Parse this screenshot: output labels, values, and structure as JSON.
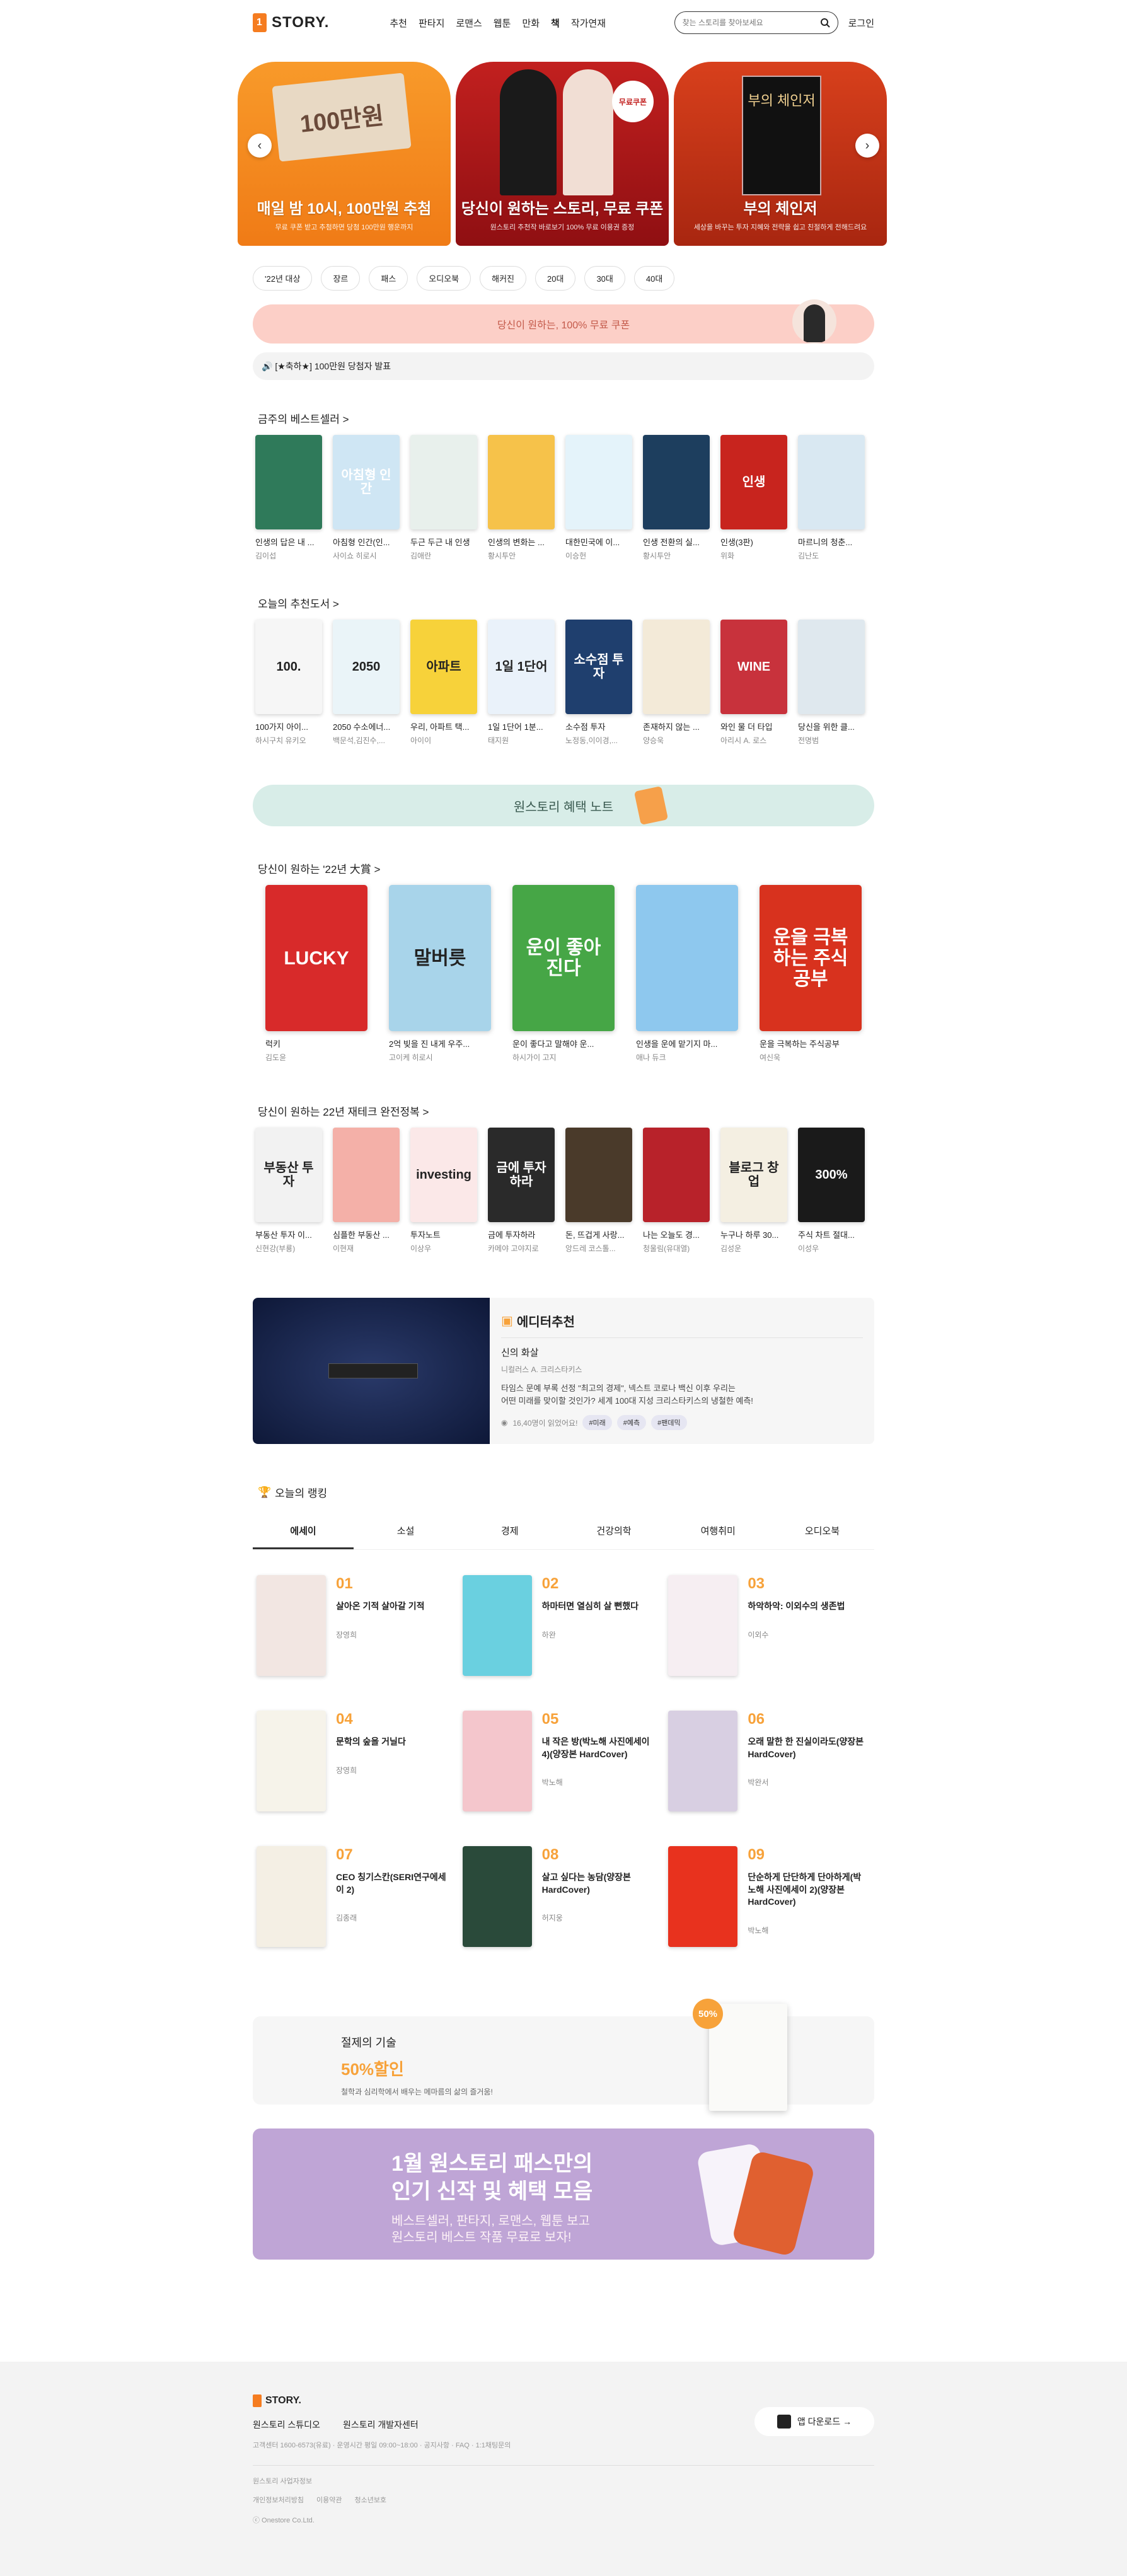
{
  "header": {
    "logo": "STORY.",
    "nav": [
      "추천",
      "판타지",
      "로맨스",
      "웹툰",
      "만화",
      "책",
      "작가연재"
    ],
    "active_nav": 5,
    "search_placeholder": "찾는 스토리를 찾아보세요",
    "login": "로그인"
  },
  "hero": {
    "slides": [
      {
        "envelope": "100만원",
        "title": "매일 밤 10시, 100만원 추첨",
        "sub": "무료 쿠폰 받고 추첨하면 당첨 100만원 행운까지"
      },
      {
        "badge": "무료쿠폰",
        "title": "당신이 원하는 스토리, 무료 쿠폰",
        "sub": "원스토리 추천작 바로보기 100% 무료 이용권 증정"
      },
      {
        "book": "부의 체인저",
        "title": "부의 체인저",
        "sub": "세상을 바꾸는 투자 지혜와 전략을 쉽고 친절하게 전해드려요"
      }
    ]
  },
  "tags": [
    "'22년 대상",
    "장르",
    "패스",
    "오디오북",
    "해커진",
    "20대",
    "30대",
    "40대"
  ],
  "pink_banner": "당신이 원하는, 100% 무료 쿠폰",
  "notice": "🔊 [★축하★] 100만원 당첨자 발표",
  "bestseller": {
    "title": "금주의 베스트셀러 >",
    "books": [
      {
        "t": "인생의 답은 내 ...",
        "a": "김이섭",
        "cover": "#2f7a5a",
        "txt": ""
      },
      {
        "t": "아침형 인간(인...",
        "a": "사이쇼 히로시",
        "cover": "#cfe6f4",
        "txt": "아침형 인간"
      },
      {
        "t": "두근 두근 내 인생",
        "a": "김애란",
        "cover": "#e8f0ec",
        "txt": ""
      },
      {
        "t": "인생의 변화는 ...",
        "a": "황시투안",
        "cover": "#f6c24a",
        "txt": ""
      },
      {
        "t": "대한민국에 이...",
        "a": "이승헌",
        "cover": "#e4f3fa",
        "txt": ""
      },
      {
        "t": "인생 전환의 실...",
        "a": "황시투안",
        "cover": "#1d3e5e",
        "txt": ""
      },
      {
        "t": "인생(3판)",
        "a": "위화",
        "cover": "#c8241e",
        "txt": "인생"
      },
      {
        "t": "마르니의 청춘...",
        "a": "김난도",
        "cover": "#d9e8f2",
        "txt": ""
      }
    ]
  },
  "recommend": {
    "title": "오늘의 추천도서 >",
    "books": [
      {
        "t": "100가지 아이...",
        "a": "하시구치 유키오",
        "cover": "#f6f6f6",
        "txt": "100."
      },
      {
        "t": "2050 수소에너...",
        "a": "백문석,김진수,...",
        "cover": "#eaf4f8",
        "txt": "2050"
      },
      {
        "t": "우리, 아파트 택...",
        "a": "아이이",
        "cover": "#f7d23a",
        "txt": "아파트"
      },
      {
        "t": "1일 1단어 1분...",
        "a": "태지원",
        "cover": "#eaf2fa",
        "txt": "1일 1단어"
      },
      {
        "t": "소수점 투자",
        "a": "노정동,이이경,...",
        "cover": "#1f3f6e",
        "txt": "소수점 투자"
      },
      {
        "t": "존재하지 않는 ...",
        "a": "양승욱",
        "cover": "#f3ead8",
        "txt": ""
      },
      {
        "t": "와인 물 더 타입",
        "a": "아리시 A. 로스",
        "cover": "#c8323c",
        "txt": "WINE"
      },
      {
        "t": "당신을 위한 클...",
        "a": "전명범",
        "cover": "#dfe8ee",
        "txt": ""
      }
    ]
  },
  "benefit": "원스토리 혜택 노트",
  "award": {
    "title": "당신이 원하는 '22년 大賞 >",
    "books": [
      {
        "t": "럭키",
        "a": "김도윤",
        "cover": "#d82a2a",
        "txt": "LUCKY"
      },
      {
        "t": "2억 빚을 진 내게 우주...",
        "a": "고이케 히로시",
        "cover": "#a8d4ea",
        "txt": "말버릇"
      },
      {
        "t": "운이 좋다고 말해야 운...",
        "a": "하시가이 고지",
        "cover": "#46a646",
        "txt": "운이 좋아진다"
      },
      {
        "t": "인생을 운에 맡기지 마...",
        "a": "애나 듀크",
        "cover": "#8ec8ee",
        "txt": ""
      },
      {
        "t": "운을 극복하는 주식공부",
        "a": "여신욱",
        "cover": "#d8321e",
        "txt": "운을 극복하는 주식공부"
      }
    ]
  },
  "invest": {
    "title": "당신이 원하는 22년 재테크 완전정복 >",
    "books": [
      {
        "t": "부동산 투자 이...",
        "a": "신현강(부룡)",
        "cover": "#f2f2f2",
        "txt": "부동산 투자"
      },
      {
        "t": "심플한 부동산 ...",
        "a": "이현재",
        "cover": "#f4b0a8",
        "txt": ""
      },
      {
        "t": "투자노트",
        "a": "이상우",
        "cover": "#fbe8e8",
        "txt": "investing"
      },
      {
        "t": "금에 투자하라",
        "a": "카메야 고야지로",
        "cover": "#2a2a2a",
        "txt": "금에 투자하라"
      },
      {
        "t": "돈, 뜨겁게 사랑...",
        "a": "앙드레 코스톨...",
        "cover": "#4a3a2a",
        "txt": ""
      },
      {
        "t": "나는 오늘도 경...",
        "a": "청울림(유대열)",
        "cover": "#b8222a",
        "txt": ""
      },
      {
        "t": "누구나 하루 30...",
        "a": "김성운",
        "cover": "#f4efe2",
        "txt": "블로그 창업"
      },
      {
        "t": "주식 차트 절대...",
        "a": "이성우",
        "cover": "#1a1a1a",
        "txt": "300%"
      }
    ]
  },
  "editor": {
    "heading": "에디터추천",
    "title": "신의 화살",
    "author": "니컬러스 A. 크리스타키스",
    "desc1": "타임스 문예 부록 선정 \"최고의 경제\", 넥스트 코로나 백신 이후 우리는",
    "desc2": "어떤 미래를 맞이할 것인가? 세계 100대 지성 크리스타키스의 냉철한 예측!",
    "likes": "16,40명이 읽었어요!",
    "chips": [
      "#미래",
      "#예측",
      "#팬데믹"
    ]
  },
  "ranking": {
    "title": "오늘의 랭킹",
    "tabs": [
      "에세이",
      "소설",
      "경제",
      "건강의학",
      "여행취미",
      "오디오북"
    ],
    "active": 0,
    "items": [
      {
        "n": "01",
        "t": "살아온 기적 살아갈 기적",
        "a": "장영희",
        "cover": "#f2e6e2"
      },
      {
        "n": "02",
        "t": "하마터면 열심히 살 뻔했다",
        "a": "하완",
        "cover": "#6ad0e0"
      },
      {
        "n": "03",
        "t": "하악하악: 이외수의 생존법",
        "a": "이외수",
        "cover": "#f6eef2"
      },
      {
        "n": "04",
        "t": "문학의 숲을 거닐다",
        "a": "장영희",
        "cover": "#f6f3ea"
      },
      {
        "n": "05",
        "t": "내 작은 방(박노해 사진에세이 4)(양장본 HardCover)",
        "a": "박노해",
        "cover": "#f4c6cc"
      },
      {
        "n": "06",
        "t": "오래 말한 한 진실이라도(양장본 HardCover)",
        "a": "박완서",
        "cover": "#d8cfe2"
      },
      {
        "n": "07",
        "t": "CEO 칭기스칸(SERI연구에세이 2)",
        "a": "김종래",
        "cover": "#f4efe4"
      },
      {
        "n": "08",
        "t": "살고 싶다는 농담(양장본 HardCover)",
        "a": "허지웅",
        "cover": "#2a4a3a"
      },
      {
        "n": "09",
        "t": "단순하게 단단하게 단아하게(박노해 사진에세이 2)(양장본 HardCover)",
        "a": "박노해",
        "cover": "#e8321e"
      }
    ]
  },
  "sale": {
    "title": "절제의 기술",
    "discount": "50%할인",
    "desc": "철학과 심리학에서 배우는 메마름의 삶의 즐거움!",
    "badge": "50%"
  },
  "pass": {
    "line1": "1월 원스토리 패스만의",
    "line2": "인기 신작 및 혜택 모음",
    "line3": "베스트셀러, 판타지, 로맨스, 웹툰 보고",
    "line4": "원스토리 베스트 작품 무료로 보자!"
  },
  "footer": {
    "logo": "STORY.",
    "links": [
      "원스토리 스튜디오",
      "원스토리 개발자센터"
    ],
    "info": "고객센터 1600-6573(유료)  ·  운영시간 평일 09:00~18:00  ·  공지사항  ·  FAQ  ·  1:1채팅문의",
    "company": "원스토리 사업자정보",
    "legal": [
      "개인정보처리방침",
      "이용약관",
      "청소년보호"
    ],
    "copyright": "ⓒ Onestore Co.Ltd.",
    "app": "앱 다운로드 →"
  },
  "colors": {
    "accent": "#f57c20",
    "orange": "#f7a23a",
    "pink": "#fccfc7",
    "mint": "#d8ede8",
    "purple": "#bfa5d6"
  }
}
